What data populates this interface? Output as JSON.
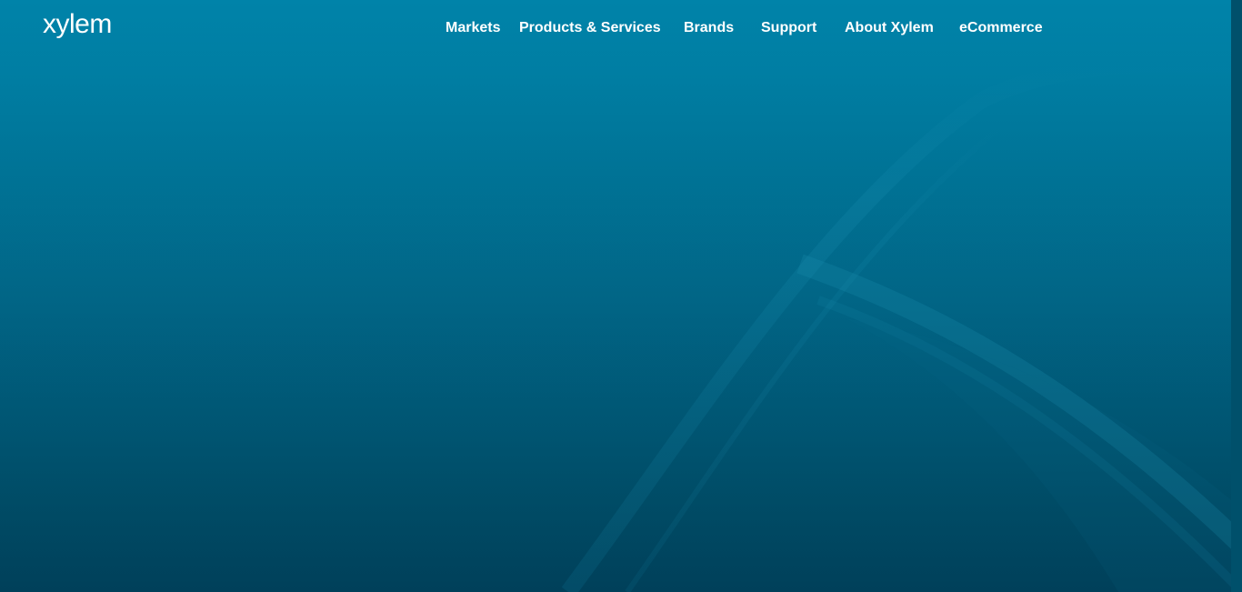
{
  "brand": {
    "logo_text": "xylem"
  },
  "nav": {
    "items": [
      {
        "label": "Markets"
      },
      {
        "label": "Products & Services"
      },
      {
        "label": "Brands"
      },
      {
        "label": "Support"
      },
      {
        "label": "About Xylem"
      },
      {
        "label": "eCommerce"
      }
    ]
  },
  "colors": {
    "hero_top": "#0083a9",
    "hero_bottom": "#00405a",
    "nav_text": "#ffffff"
  }
}
